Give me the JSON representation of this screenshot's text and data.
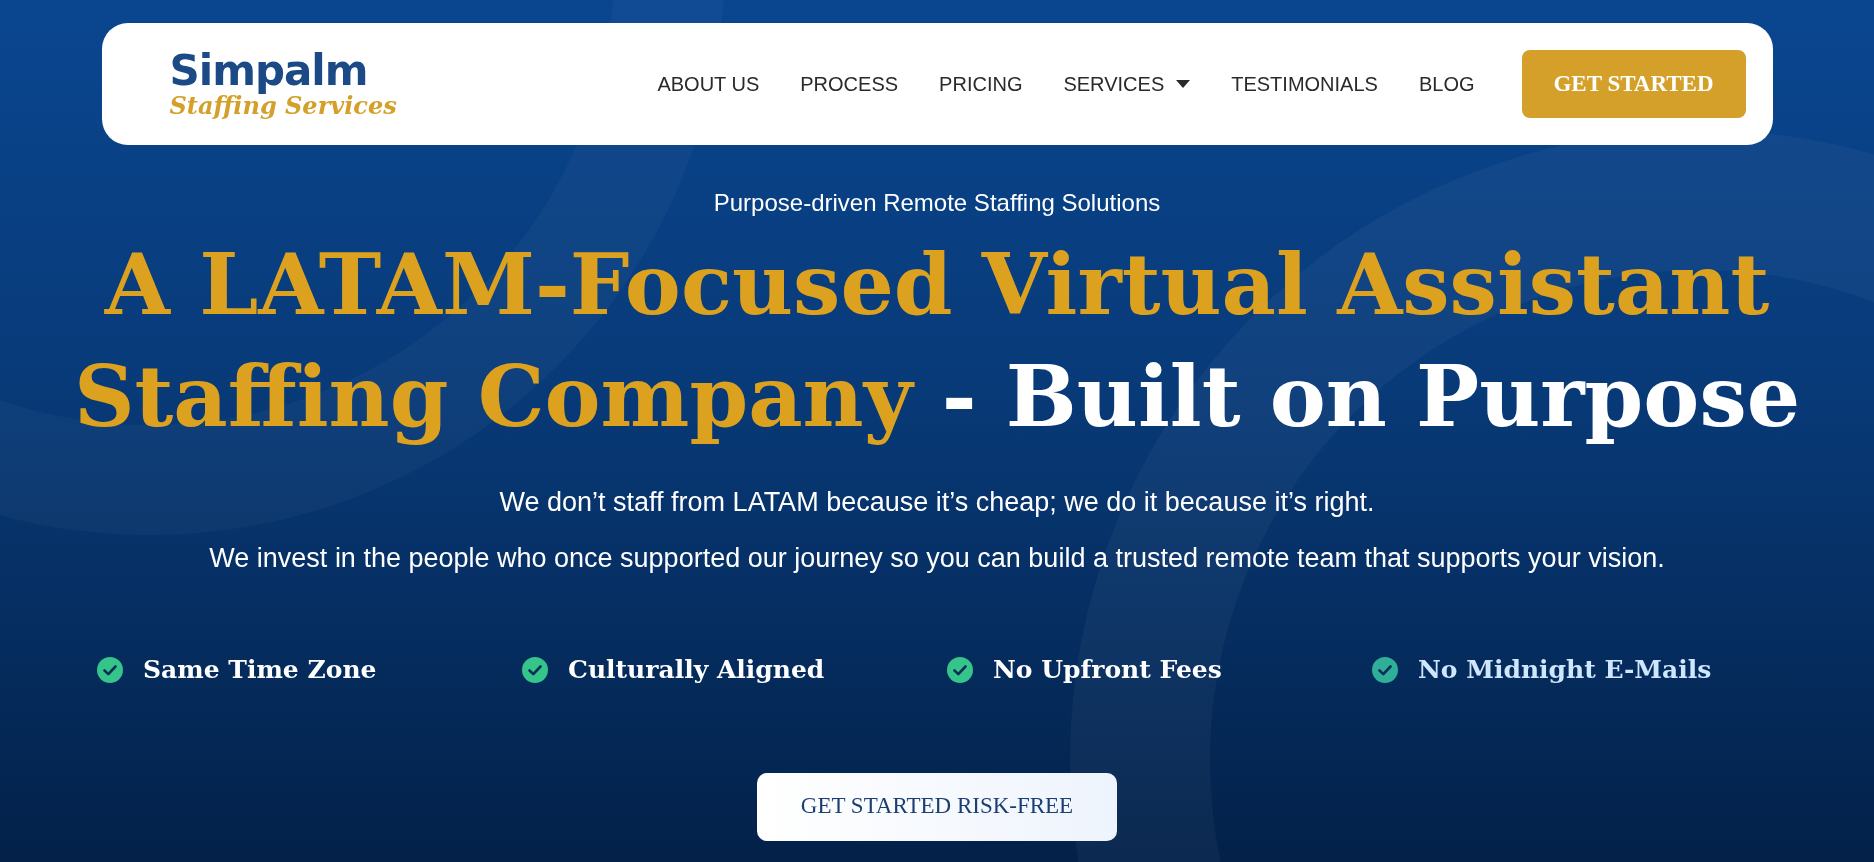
{
  "logo": {
    "name": "Simpalm",
    "tagline": "Staffing Services"
  },
  "nav": {
    "items": [
      {
        "label": "ABOUT US",
        "has_menu": false
      },
      {
        "label": "PROCESS",
        "has_menu": false
      },
      {
        "label": "PRICING",
        "has_menu": false
      },
      {
        "label": "SERVICES",
        "has_menu": true
      },
      {
        "label": "TESTIMONIALS",
        "has_menu": false
      },
      {
        "label": "BLOG",
        "has_menu": false
      }
    ],
    "cta": "GET STARTED"
  },
  "hero": {
    "eyebrow": "Purpose-driven Remote Staffing Solutions",
    "heading": {
      "accent": "A LATAM-Focused Virtual Assistant Staffing Company",
      "plain": "- Built on Purpose"
    },
    "paragraphs": [
      "We don’t staff from LATAM because it’s cheap; we do it because it’s right.",
      "We invest in the people who once supported our journey so you can build a trusted remote team that supports your vision."
    ],
    "features": [
      {
        "label": "Same Time Zone",
        "highlighted": false
      },
      {
        "label": "Culturally Aligned",
        "highlighted": false
      },
      {
        "label": "No Upfront Fees",
        "highlighted": false
      },
      {
        "label": "No Midnight E-Mails",
        "highlighted": true
      }
    ],
    "cta": "GET STARTED RISK-FREE"
  }
}
